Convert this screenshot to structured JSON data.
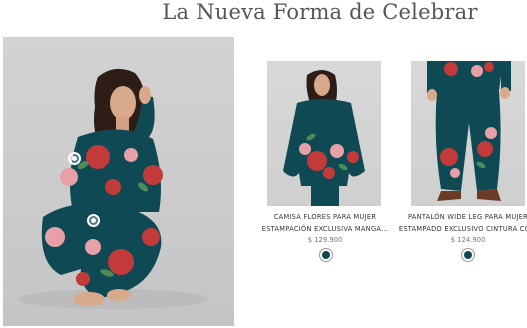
{
  "section": {
    "title": "La Nueva Forma de Celebrar"
  },
  "colors": {
    "teal_fabric": "#0f4a54",
    "flower_red": "#c23a3a",
    "flower_pink": "#e7a0a8"
  },
  "products": [
    {
      "name_line1": "CAMISA FLORES PARA MUJER",
      "name_line2": "ESTAMPACIÓN EXCLUSIVA MANGA...",
      "price": "$ 129.900",
      "swatch_color": "#0f4a54"
    },
    {
      "name_line1": "PANTALÓN WIDE LEG PARA MUJER",
      "name_line2": "ESTAMPADO EXCLUSIVO CINTURA CO...",
      "price": "$ 124.900",
      "swatch_color": "#0f4a54"
    }
  ]
}
